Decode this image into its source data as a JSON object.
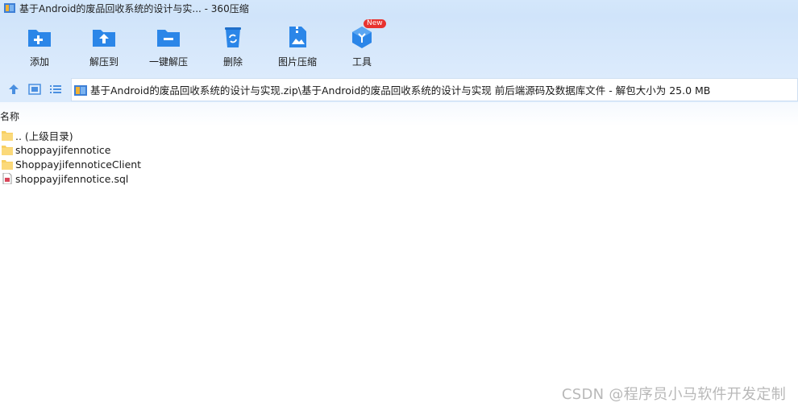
{
  "window": {
    "title": "基于Android的废品回收系统的设计与实... - 360压缩"
  },
  "toolbar": {
    "items": [
      {
        "label": "添加",
        "icon": "add-folder-icon"
      },
      {
        "label": "解压到",
        "icon": "extract-to-icon"
      },
      {
        "label": "一键解压",
        "icon": "one-click-extract-icon"
      },
      {
        "label": "删除",
        "icon": "recycle-bin-icon"
      },
      {
        "label": "图片压缩",
        "icon": "image-compress-icon"
      },
      {
        "label": "工具",
        "icon": "tools-cube-icon",
        "badge": "New"
      }
    ]
  },
  "address": {
    "path": "基于Android的废品回收系统的设计与实现.zip\\基于Android的废品回收系统的设计与实现 前后端源码及数据库文件 - 解包大小为 25.0 MB"
  },
  "filelist": {
    "column_name": "名称",
    "rows": [
      {
        "name": ".. (上级目录)",
        "type": "folder"
      },
      {
        "name": "shoppayjifennotice",
        "type": "folder"
      },
      {
        "name": "ShoppayjifennoticeClient",
        "type": "folder"
      },
      {
        "name": "shoppayjifennotice.sql",
        "type": "sql"
      }
    ]
  },
  "watermark": "CSDN @程序员小马软件开发定制",
  "colors": {
    "accent": "#2b86e8",
    "folder": "#f7cf61",
    "badge": "#e8322f"
  }
}
